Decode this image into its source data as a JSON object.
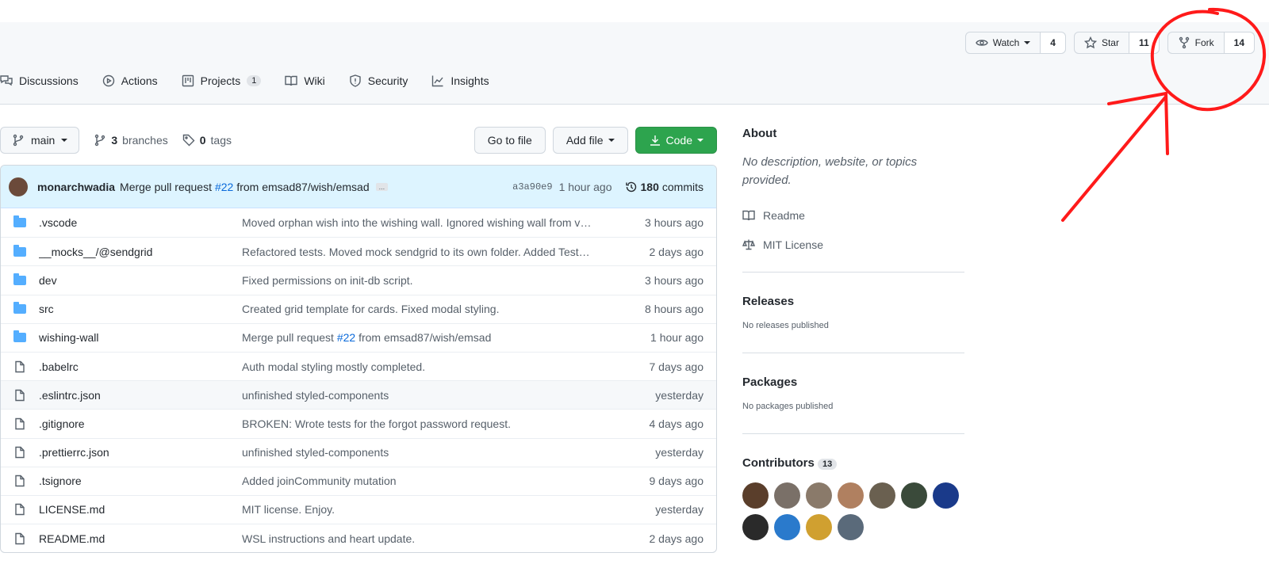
{
  "repo_actions": {
    "watch": {
      "label": "Watch",
      "count": "4"
    },
    "star": {
      "label": "Star",
      "count": "11"
    },
    "fork": {
      "label": "Fork",
      "count": "14"
    }
  },
  "nav": {
    "discussions": "Discussions",
    "actions": "Actions",
    "projects": "Projects",
    "projects_count": "1",
    "wiki": "Wiki",
    "security": "Security",
    "insights": "Insights"
  },
  "toolbar": {
    "branch": "main",
    "branches_count": "3",
    "branches_label": "branches",
    "tags_count": "0",
    "tags_label": "tags",
    "go_to_file": "Go to file",
    "add_file": "Add file",
    "code": "Code"
  },
  "latest_commit": {
    "author": "monarchwadia",
    "message_pre": "Merge pull request",
    "pr": "#22",
    "message_post": "from emsad87/wish/emsad",
    "ellipsis": "...",
    "sha": "a3a90e9",
    "age": "1 hour ago",
    "commits_count": "180",
    "commits_label": "commits"
  },
  "files": [
    {
      "type": "dir",
      "name": ".vscode",
      "msg": "Moved orphan wish into the wishing wall. Ignored wishing wall from vs...",
      "age": "3 hours ago"
    },
    {
      "type": "dir",
      "name": "__mocks__/@sendgrid",
      "msg": "Refactored tests. Moved mock sendgrid to its own folder. Added TestMa...",
      "age": "2 days ago"
    },
    {
      "type": "dir",
      "name": "dev",
      "msg": "Fixed permissions on init-db script.",
      "age": "3 hours ago"
    },
    {
      "type": "dir",
      "name": "src",
      "msg": "Created grid template for cards. Fixed modal styling.",
      "age": "8 hours ago"
    },
    {
      "type": "dir",
      "name": "wishing-wall",
      "msg": "Merge pull request #22 from emsad87/wish/emsad",
      "age": "1 hour ago"
    },
    {
      "type": "file",
      "name": ".babelrc",
      "msg": "Auth modal styling mostly completed.",
      "age": "7 days ago"
    },
    {
      "type": "file",
      "name": ".eslintrc.json",
      "msg": "unfinished styled-components",
      "age": "yesterday"
    },
    {
      "type": "file",
      "name": ".gitignore",
      "msg": "BROKEN: Wrote tests for the forgot password request.",
      "age": "4 days ago"
    },
    {
      "type": "file",
      "name": ".prettierrc.json",
      "msg": "unfinished styled-components",
      "age": "yesterday"
    },
    {
      "type": "file",
      "name": ".tsignore",
      "msg": "Added joinCommunity mutation",
      "age": "9 days ago"
    },
    {
      "type": "file",
      "name": "LICENSE.md",
      "msg": "MIT license. Enjoy.",
      "age": "yesterday"
    },
    {
      "type": "file",
      "name": "README.md",
      "msg": "WSL instructions and heart update.",
      "age": "2 days ago"
    }
  ],
  "sidebar": {
    "about_title": "About",
    "about_desc": "No description, website, or topics provided.",
    "readme": "Readme",
    "license": "MIT License",
    "releases_title": "Releases",
    "releases_none": "No releases published",
    "packages_title": "Packages",
    "packages_none": "No packages published",
    "contributors_title": "Contributors",
    "contributors_count": "13",
    "avatar_colors": [
      "#5a3e2b",
      "#7a7068",
      "#8a7a6a",
      "#b08060",
      "#6a6050",
      "#3a4a3a",
      "#1a3a8a",
      "#2a2a2a",
      "#2a7acc",
      "#d0a030",
      "#5a6a7a"
    ]
  },
  "colors": {
    "annotation": "#ff1a1a",
    "code_button": "#2da44e",
    "link": "#0969da"
  }
}
